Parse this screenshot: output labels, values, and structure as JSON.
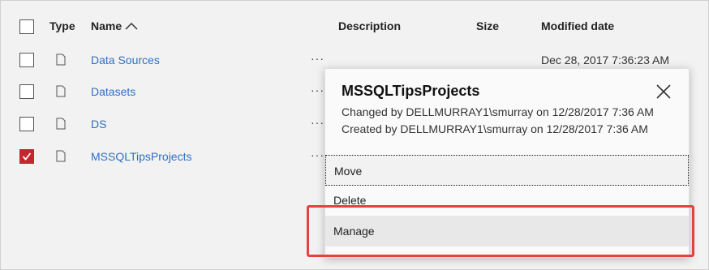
{
  "header": {
    "type_label": "Type",
    "name_label": "Name",
    "description_label": "Description",
    "size_label": "Size",
    "modified_label": "Modified date"
  },
  "rows": [
    {
      "name": "Data Sources",
      "ellipsis": "···",
      "modified": "Dec 28, 2017 7:36:23 AM",
      "checked": false
    },
    {
      "name": "Datasets",
      "ellipsis": "···",
      "modified": "",
      "checked": false
    },
    {
      "name": "DS",
      "ellipsis": "···",
      "modified": "",
      "checked": false
    },
    {
      "name": "MSSQLTipsProjects",
      "ellipsis": "···",
      "modified": "",
      "checked": true
    }
  ],
  "popup": {
    "title": "MSSQLTipsProjects",
    "changed_by": "Changed by DELLMURRAY1\\smurray on 12/28/2017 7:36 AM",
    "created_by": "Created by DELLMURRAY1\\smurray on 12/28/2017 7:36 AM",
    "menu": {
      "move": "Move",
      "delete": "Delete",
      "manage": "Manage"
    }
  },
  "colors": {
    "link": "#2f6fc4",
    "checked": "#c4262e",
    "highlight": "#e0443c"
  }
}
